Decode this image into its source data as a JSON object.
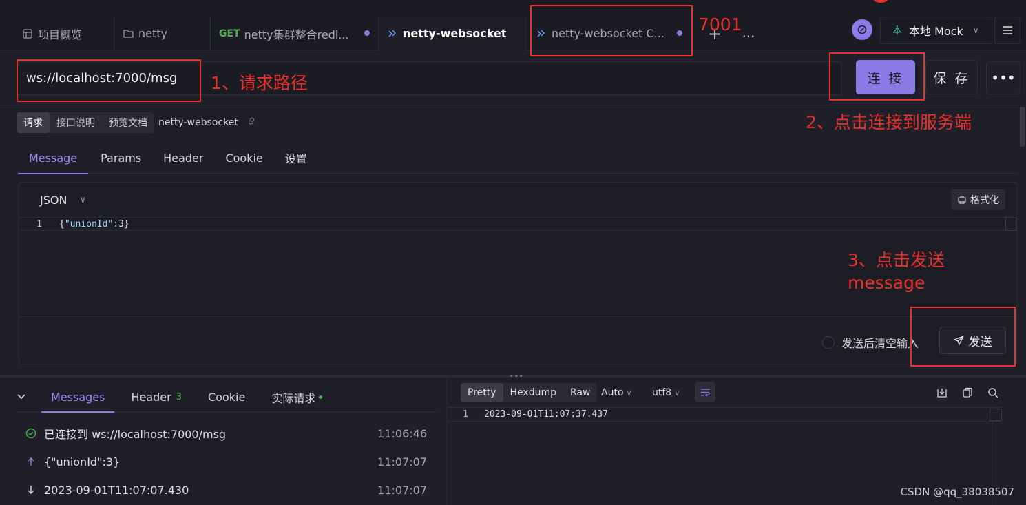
{
  "tabs": [
    {
      "label": "项目概览",
      "icon": "overview-icon"
    },
    {
      "label": "netty",
      "icon": "folder-icon"
    },
    {
      "method": "GET",
      "label": "netty集群整合redi...",
      "unsaved": true
    },
    {
      "label": "netty-websocket",
      "icon": "websocket-icon",
      "active": true
    },
    {
      "label": "netty-websocket C...",
      "icon": "websocket-icon",
      "unsaved": true
    }
  ],
  "tabbar": {
    "add_label": "+",
    "more_label": "...",
    "env_badge": "本",
    "env_label": "本地 Mock"
  },
  "request": {
    "url": "ws://localhost:7000/msg",
    "connect_label": "连 接",
    "save_label": "保 存",
    "more_label": "•••"
  },
  "doc_tabs": [
    "请求",
    "接口说明",
    "预览文档"
  ],
  "doc_name": "netty-websocket",
  "req_tabs": [
    "Message",
    "Params",
    "Header",
    "Cookie",
    "设置"
  ],
  "editor": {
    "format": "JSON",
    "format_button": "格式化",
    "line_no": "1",
    "code_key": "\"unionId\"",
    "code_value": ":3}",
    "code_open": "{",
    "clear_label": "发送后清空输入",
    "send_label": "发送"
  },
  "response": {
    "tabs": [
      {
        "label": "Messages"
      },
      {
        "label": "Header",
        "count": "3"
      },
      {
        "label": "Cookie"
      },
      {
        "label": "实际请求"
      }
    ],
    "messages": [
      {
        "type": "connected",
        "text": "已连接到 ws://localhost:7000/msg",
        "time": "11:06:46"
      },
      {
        "type": "sent",
        "text": "{\"unionId\":3}",
        "time": "11:07:07"
      },
      {
        "type": "received",
        "text": "2023-09-01T11:07:07.430",
        "time": "11:07:07"
      }
    ],
    "views": [
      "Pretty",
      "Hexdump",
      "Raw"
    ],
    "encoding_auto": "Auto",
    "charset": "utf8",
    "line_no": "1",
    "body": "2023-09-01T11:07:37.437"
  },
  "annotations": {
    "port_note": "7001",
    "step1": "1、请求路径",
    "step2": "2、点击连接到服务端",
    "step3_line1": "3、点击发送",
    "step3_line2": "message",
    "color": "#e8312b"
  },
  "watermark": "CSDN @qq_38038507",
  "colors": {
    "accent": "#8c7ae6",
    "success": "#4caf50",
    "background": "#1f1f29"
  }
}
